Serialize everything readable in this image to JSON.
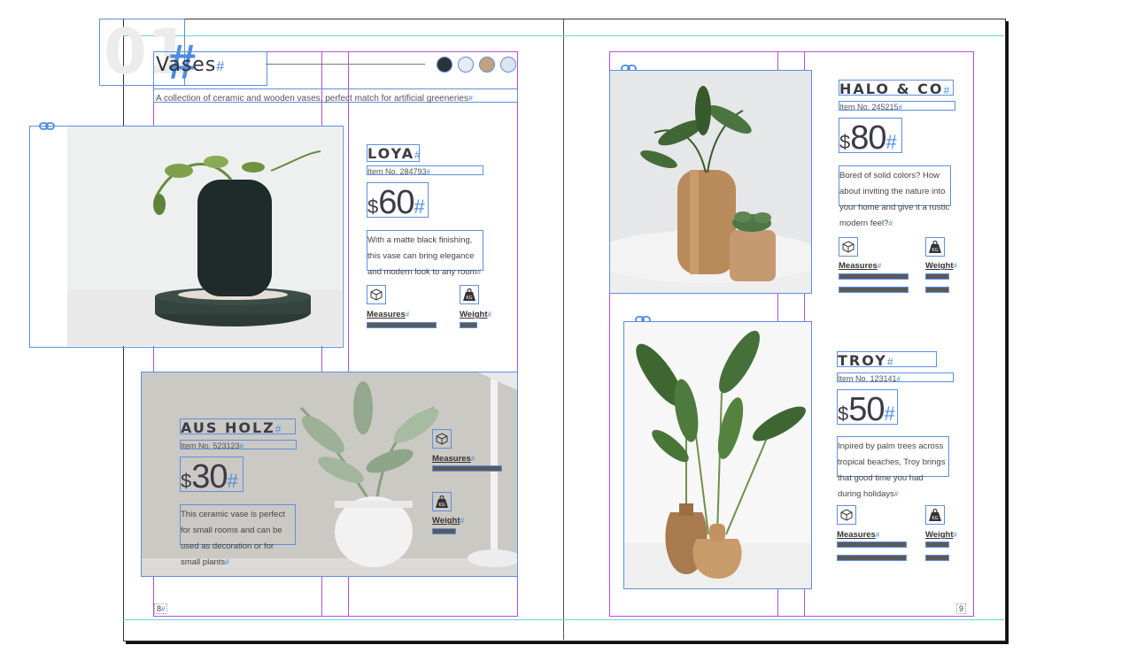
{
  "header": {
    "big_number": "01",
    "title": "Vases",
    "subtitle": "A collection of ceramic and wooden vases, perfect match for artificial greeneries"
  },
  "swatches": [
    "#2a3338",
    "#e6ecf3",
    "#c4a07c",
    "#dde4f2"
  ],
  "labels": {
    "measures": "Measures",
    "weight": "Weight",
    "kg": "KG",
    "hash": "#",
    "currency": "$"
  },
  "products": {
    "loya": {
      "name": "LOYA",
      "item_no": "Item No. 284793",
      "price": "60",
      "description": "With a matte black finishing, this vase can bring elegance and modern look to any room"
    },
    "aus_holz": {
      "name": "AUS HOLZ",
      "item_no": "Item No. 523123",
      "price": "30",
      "description": "This ceramic vase is perfect for small rooms and can be used as decoration or for small plants"
    },
    "halo_co": {
      "name": "HALO & CO",
      "item_no": "Item No. 245215",
      "price": "80",
      "description": "Bored of solid colors? How about inviting the nature into your home and give it a rustic modern feel?"
    },
    "troy": {
      "name": "TROY",
      "item_no": "Item No. 123141",
      "price": "50",
      "description": "Inpired by palm trees across tropical beaches, Troy brings that good time you had during holidays"
    }
  },
  "page_numbers": {
    "left": "8",
    "right": "9"
  }
}
